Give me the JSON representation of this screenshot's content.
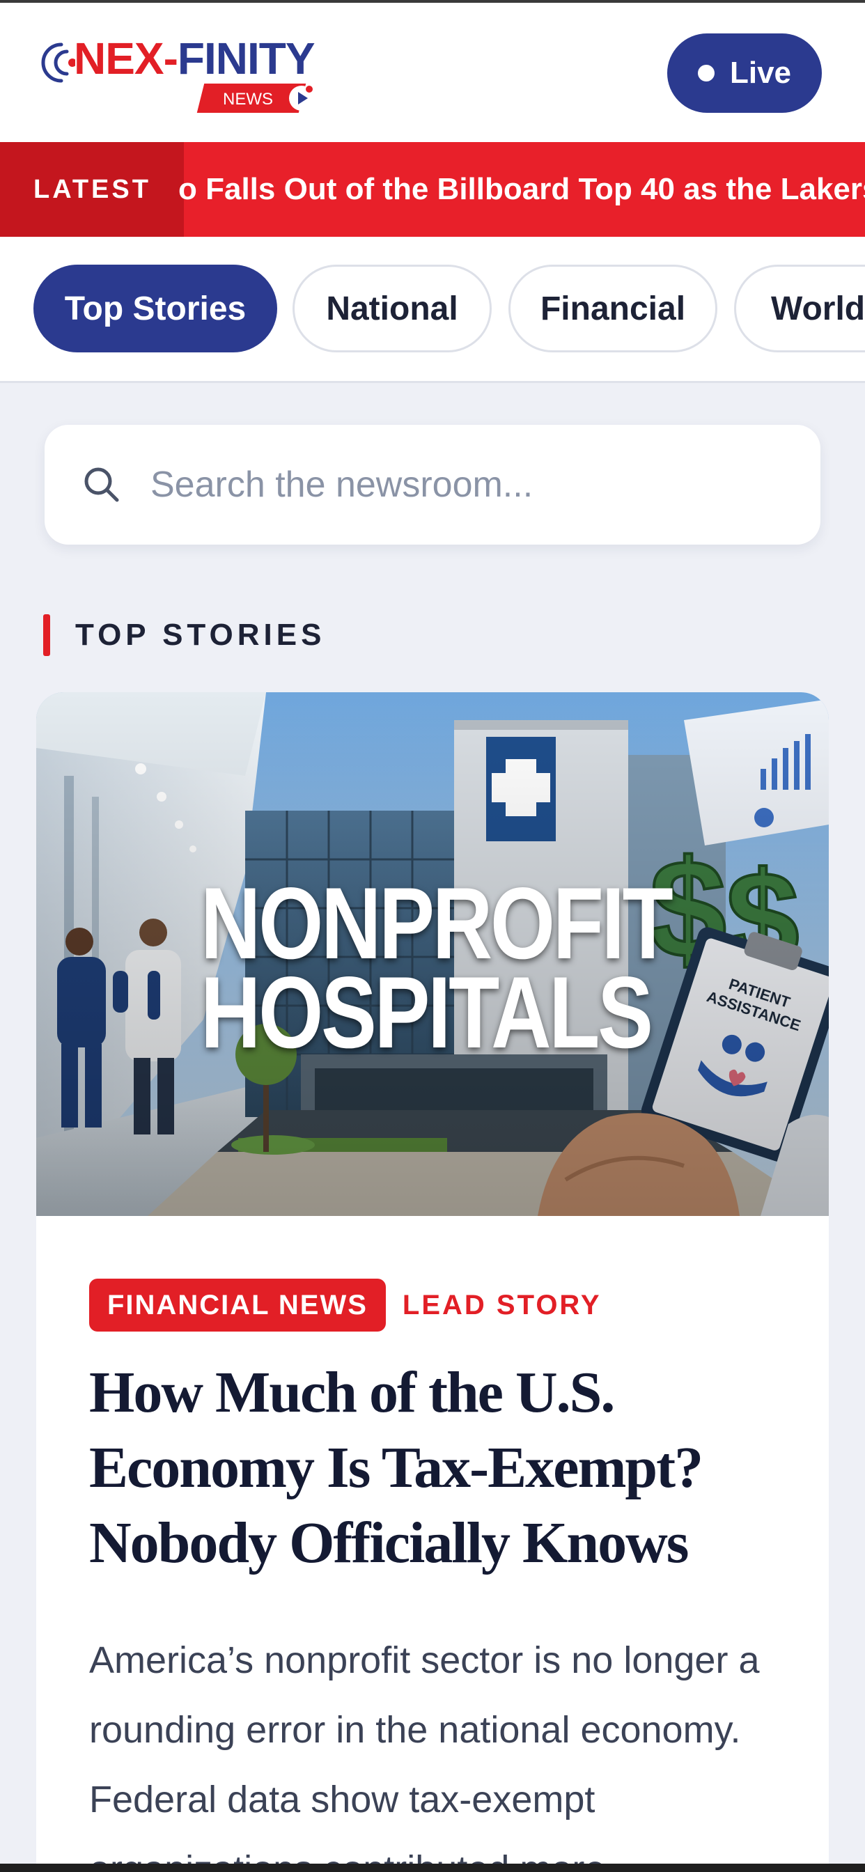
{
  "brand": {
    "name_part1": "NEX-",
    "name_part2": "FINITY",
    "sub": "NEWS"
  },
  "header": {
    "live_label": "Live"
  },
  "ticker": {
    "tag": "LATEST",
    "text": "o Falls Out of the Billboard Top 40 as the Lakers"
  },
  "tabs": [
    {
      "label": "Top Stories",
      "active": true
    },
    {
      "label": "National",
      "active": false
    },
    {
      "label": "Financial",
      "active": false
    },
    {
      "label": "World",
      "active": false
    }
  ],
  "search": {
    "placeholder": "Search the newsroom..."
  },
  "section": {
    "title": "TOP STORIES"
  },
  "lead_story": {
    "image_caption_line1": "NONPROFIT",
    "image_caption_line2": "HOSPITALS",
    "clipboard_text": "PATIENT ASSISTANCE",
    "category": "FINANCIAL NEWS",
    "label": "LEAD STORY",
    "headline": "How Much of the U.S. Economy Is Tax-Exempt? Nobody Officially Knows",
    "summary": "America’s nonprofit sector is no longer a rounding error in the national economy. Federal data show tax-exempt organizations contributed more"
  },
  "colors": {
    "brand_red": "#e21f26",
    "brand_blue": "#2b3a8f",
    "page_bg": "#eef0f6"
  }
}
